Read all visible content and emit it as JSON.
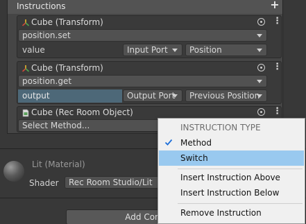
{
  "panel": {
    "title": "Instructions"
  },
  "cards": [
    {
      "title": "Cube (Transform)",
      "method": "position.set",
      "row": {
        "label": "value",
        "port": "Input Port",
        "value": "Position"
      }
    },
    {
      "title": "Cube (Transform)",
      "method": "position.get",
      "row": {
        "label": "output",
        "port": "Output Port",
        "value": "Previous Position"
      }
    },
    {
      "title": "Cube (Rec Room Object)",
      "method": "Select Method..."
    }
  ],
  "material": {
    "title": "Lit (Material)",
    "shader_label": "Shader",
    "shader_value": "Rec Room Studio/Lit"
  },
  "add_component": {
    "label": "Add Compo"
  },
  "context_menu": {
    "header": "INSTRUCTION TYPE",
    "items": [
      {
        "label": "Method",
        "checked": true
      },
      {
        "label": "Switch",
        "highlighted": true
      },
      {
        "label": "Insert Instruction Above"
      },
      {
        "label": "Insert Instruction Below"
      },
      {
        "label": "Remove Instruction"
      }
    ]
  },
  "colors": {
    "highlight": "#99c9ef",
    "check": "#1e6fd9",
    "output_row": "#4d6878"
  }
}
